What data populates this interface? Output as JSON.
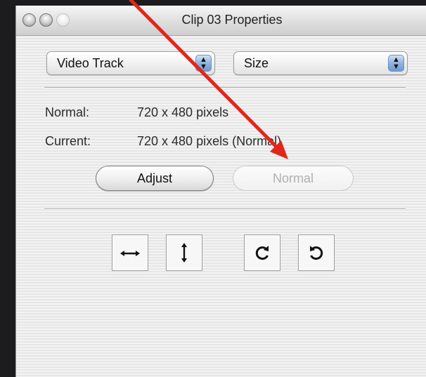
{
  "window": {
    "title": "Clip 03 Properties"
  },
  "popups": {
    "track": "Video Track",
    "property": "Size"
  },
  "info": {
    "normal_label": "Normal:",
    "normal_value": "720 x 480 pixels",
    "current_label": "Current:",
    "current_value": "720 x 480 pixels (Normal)"
  },
  "buttons": {
    "adjust": "Adjust",
    "normal": "Normal"
  },
  "tools": [
    "flip-horizontal-icon",
    "flip-vertical-icon",
    "rotate-clockwise-icon",
    "rotate-counterclockwise-icon"
  ],
  "colors": {
    "annotation_arrow": "#e2261a",
    "background": "#1c1c1e"
  }
}
